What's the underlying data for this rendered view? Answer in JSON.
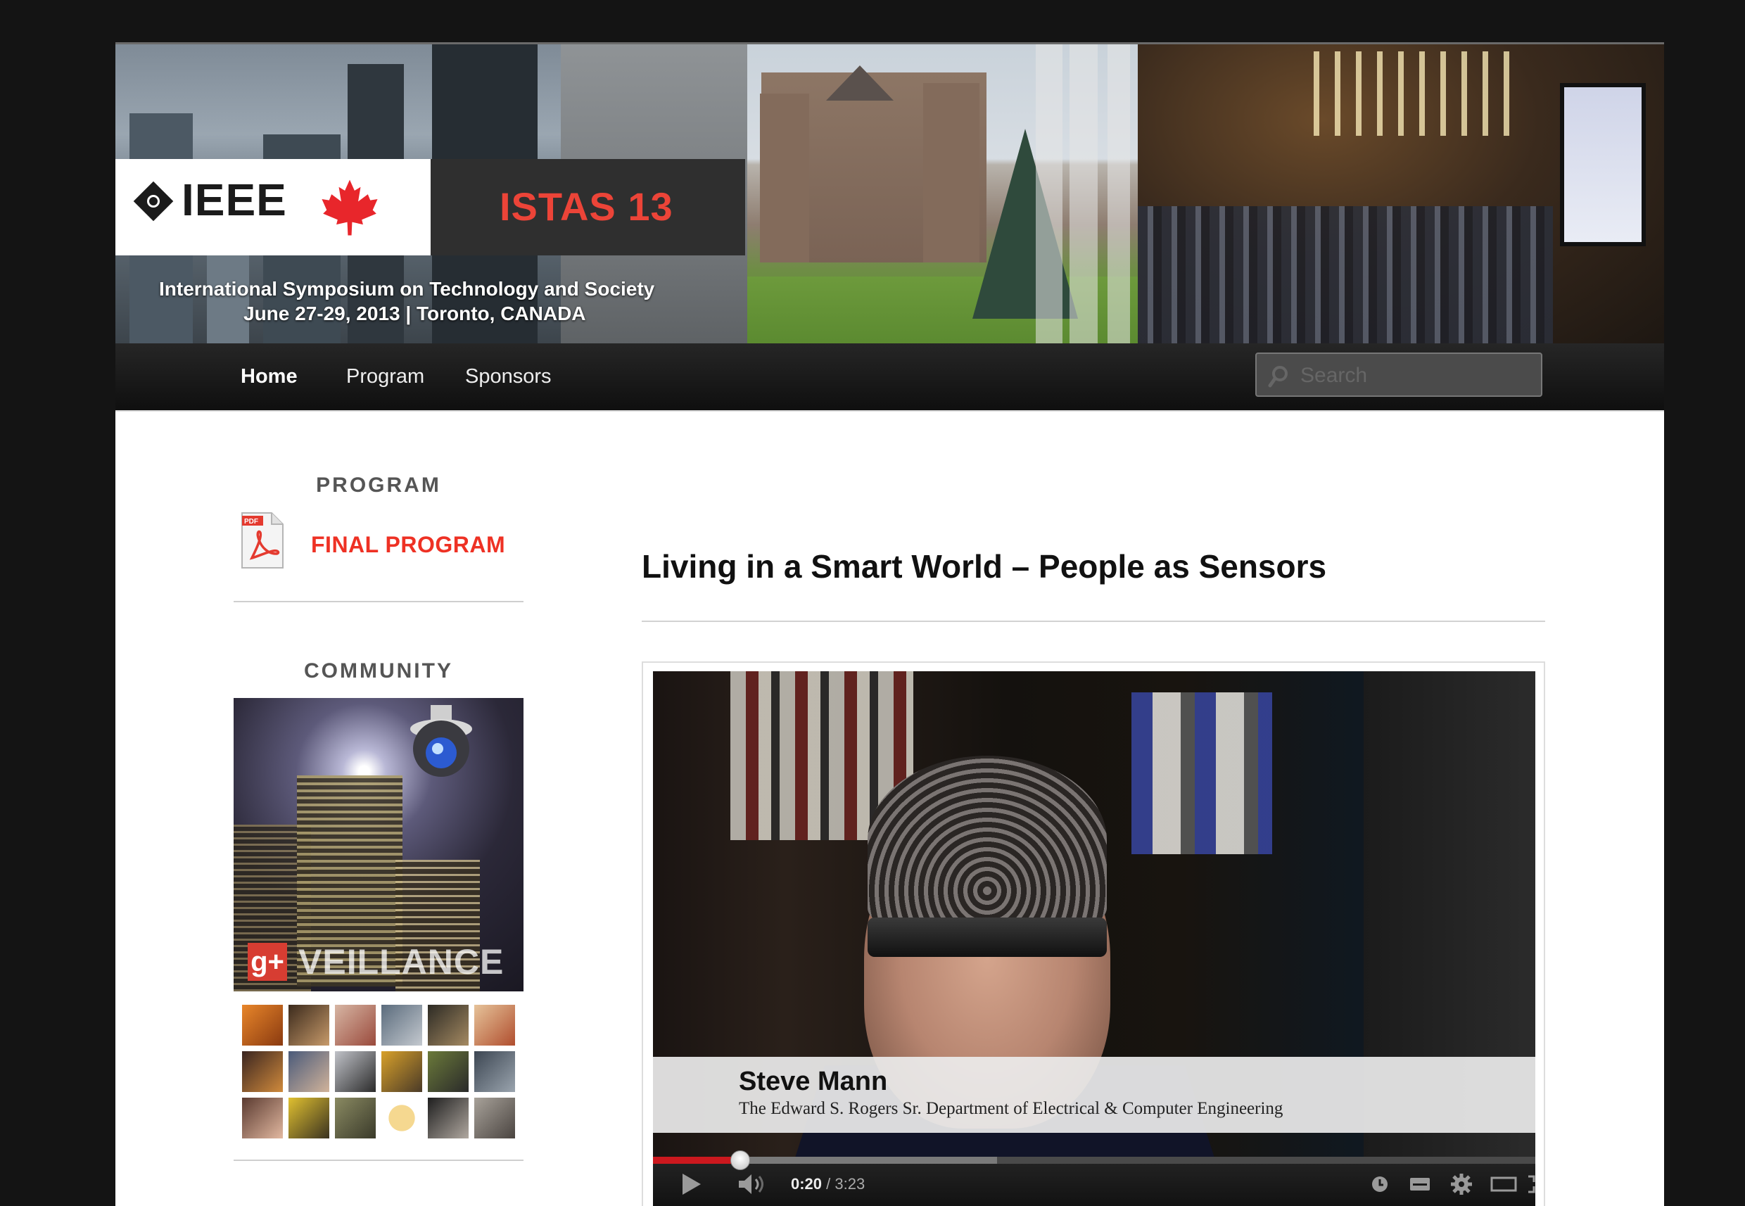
{
  "banner": {
    "logo_text": "IEEE",
    "event_title": "ISTAS 13",
    "subtitle_line1": "International Symposium on Technology and Society",
    "subtitle_line2": "June 27-29, 2013 | Toronto, CANADA"
  },
  "nav": {
    "items": [
      {
        "label": "Home",
        "active": true
      },
      {
        "label": "Program",
        "active": false
      },
      {
        "label": "Sponsors",
        "active": false
      }
    ],
    "search_placeholder": "Search"
  },
  "sidebar": {
    "program_title": "PROGRAM",
    "pdf_badge": "PDF",
    "final_program_link": "FINAL PROGRAM",
    "community_title": "COMMUNITY",
    "community_image_label": "VEILLANCE",
    "community_image_gplus": "g+"
  },
  "main": {
    "post_title": "Living in a Smart World – People as Sensors",
    "video": {
      "lower_third_name": "Steve Mann",
      "lower_third_dept": "The Edward S. Rogers Sr. Department of Electrical & Computer Engineering",
      "current_time": "0:20",
      "duration": "/ 3:23",
      "progress_fraction": 0.0985,
      "buffered_fraction": 0.39
    }
  },
  "colors": {
    "accent_red": "#ee3124",
    "istas_red": "#ec4438",
    "progress_red": "#cc181e",
    "nav_bg": "#1a1a1a",
    "page_bg": "#141414"
  },
  "icons": [
    "ieee-diamond-icon",
    "maple-leaf-icon",
    "search-icon",
    "pdf-file-icon",
    "security-camera-icon",
    "gplus-icon",
    "play-icon",
    "volume-icon",
    "watch-later-icon",
    "captions-icon",
    "settings-icon",
    "theater-mode-icon",
    "fullscreen-icon"
  ]
}
